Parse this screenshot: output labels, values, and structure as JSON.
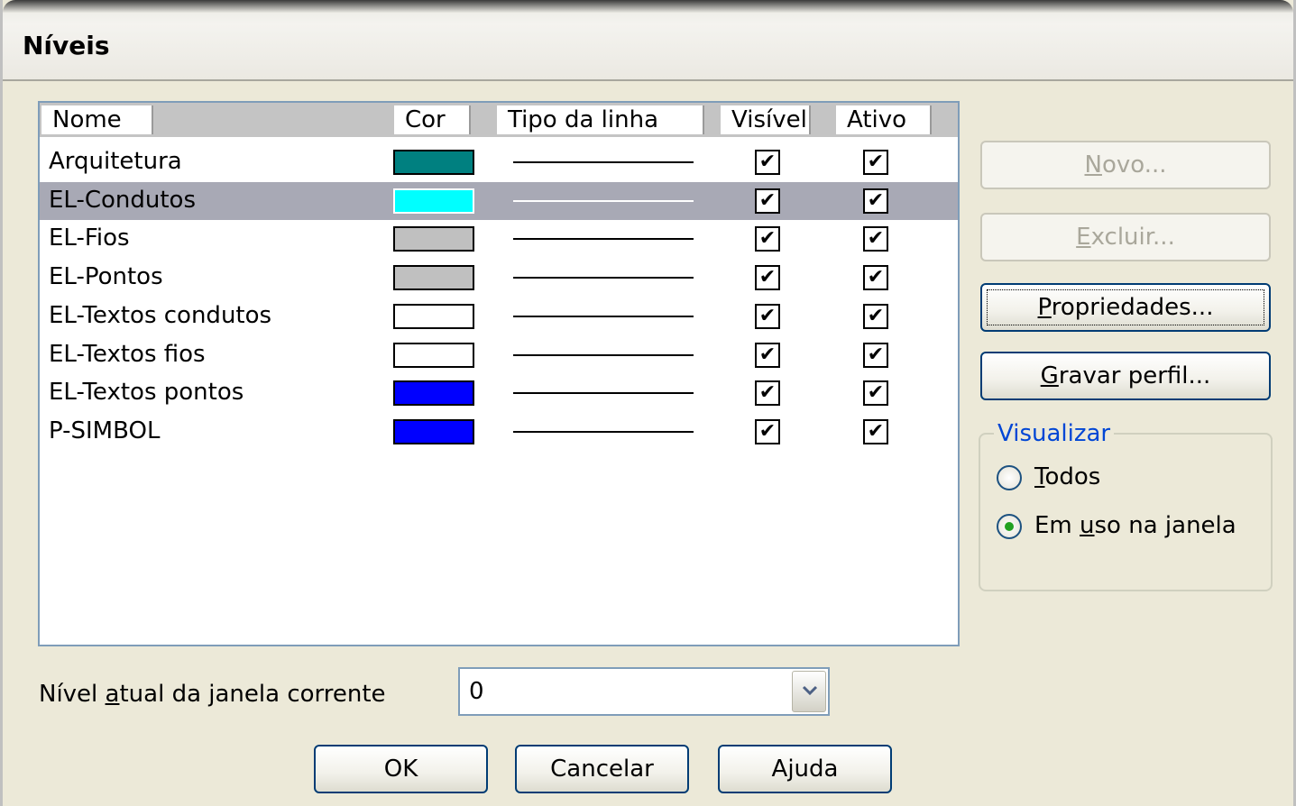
{
  "window": {
    "title": "Níveis"
  },
  "list": {
    "columns": [
      "Nome",
      "Cor",
      "Tipo da linha",
      "Visível",
      "Ativo"
    ],
    "rows": [
      {
        "name": "Arquitetura",
        "color": "#008080",
        "visible": true,
        "active": true,
        "selected": false
      },
      {
        "name": "EL-Condutos",
        "color": "#00ffff",
        "visible": true,
        "active": true,
        "selected": true
      },
      {
        "name": "EL-Fios",
        "color": "#c0c0c0",
        "visible": true,
        "active": true,
        "selected": false
      },
      {
        "name": "EL-Pontos",
        "color": "#c0c0c0",
        "visible": true,
        "active": true,
        "selected": false
      },
      {
        "name": "EL-Textos condutos",
        "color": "#ffffff",
        "visible": true,
        "active": true,
        "selected": false
      },
      {
        "name": "EL-Textos fios",
        "color": "#ffffff",
        "visible": true,
        "active": true,
        "selected": false
      },
      {
        "name": "EL-Textos pontos",
        "color": "#0000ff",
        "visible": true,
        "active": true,
        "selected": false
      },
      {
        "name": "P-SIMBOL",
        "color": "#0000ff",
        "visible": true,
        "active": true,
        "selected": false
      }
    ],
    "check_glyph": "✔"
  },
  "side_buttons": {
    "novo": {
      "pre": "",
      "mnemonic": "N",
      "post": "ovo..."
    },
    "excluir": {
      "pre": "",
      "mnemonic": "E",
      "post": "xcluir..."
    },
    "propriedades": {
      "pre": "",
      "mnemonic": "P",
      "post": "ropriedades..."
    },
    "gravar": {
      "pre": "",
      "mnemonic": "G",
      "post": "ravar perfil..."
    }
  },
  "visualizar": {
    "label": "Visualizar",
    "todos": {
      "pre": "",
      "mnemonic": "T",
      "post": "odos"
    },
    "em_uso": {
      "pre": "Em ",
      "mnemonic": "u",
      "post": "so na janela"
    },
    "selected": "em_uso"
  },
  "level": {
    "label_pre": "Nível ",
    "label_mnemonic": "a",
    "label_post": "tual da janela corrente",
    "value": "0"
  },
  "bottom_buttons": {
    "ok": "OK",
    "cancel": "Cancelar",
    "help": "Ajuda"
  },
  "colors": {
    "selection": "#a8a9b5",
    "group_label": "#0046d5",
    "button_border": "#003c74"
  }
}
